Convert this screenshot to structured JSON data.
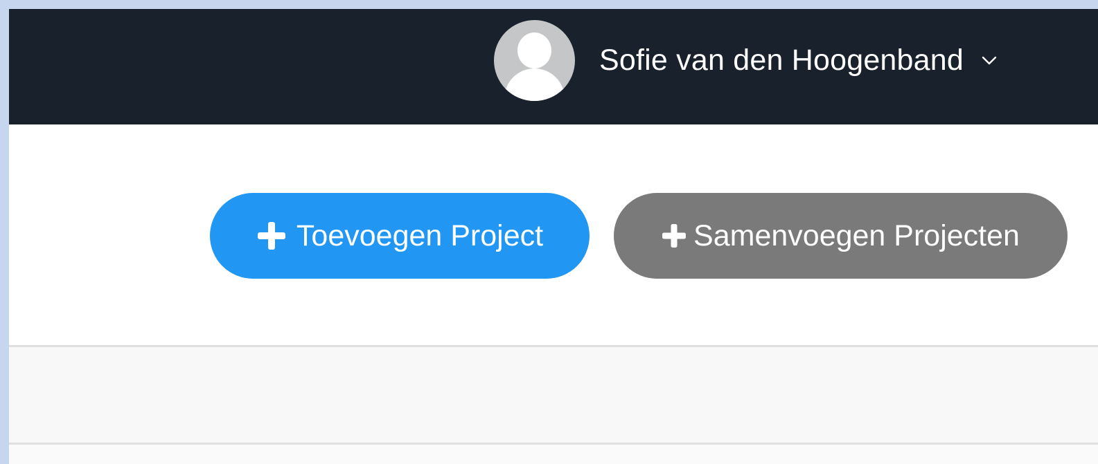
{
  "header": {
    "user": {
      "name": "Sofie van den Hoogenband",
      "avatar_icon": "user-avatar-icon",
      "dropdown_icon": "chevron-down-icon"
    }
  },
  "actions": {
    "add_project_label": "Toevoegen Project",
    "merge_projects_label": "Samenvoegen Projecten",
    "button_icon": "plus-icon"
  },
  "colors": {
    "topbar_bg": "#19212c",
    "primary": "#2196f3",
    "secondary": "#7a7a7a",
    "avatar_bg": "#c5c6c7",
    "outer_frame": "#c5d6ee"
  }
}
